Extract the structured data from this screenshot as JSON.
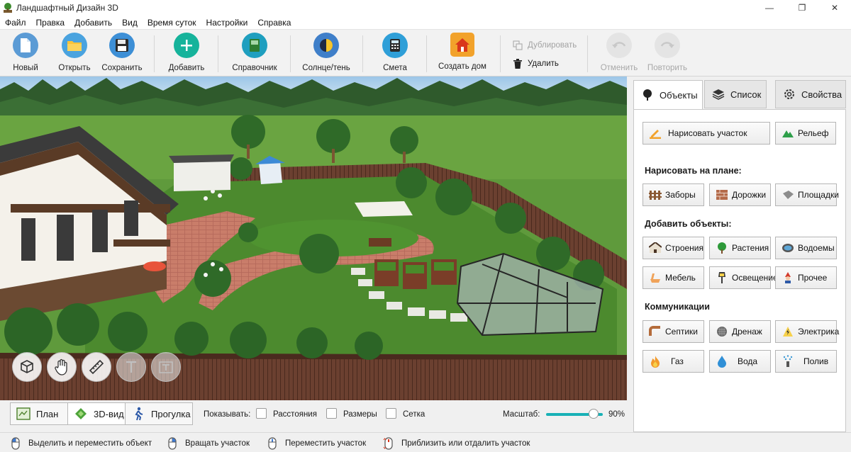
{
  "window": {
    "title": "Ландшафтный Дизайн 3D",
    "controls": {
      "minimize": "—",
      "maximize": "❐",
      "close": "✕"
    }
  },
  "menu": [
    "Файл",
    "Правка",
    "Добавить",
    "Вид",
    "Время суток",
    "Настройки",
    "Справка"
  ],
  "toolbar": {
    "new": "Новый",
    "open": "Открыть",
    "save": "Сохранить",
    "add": "Добавить",
    "reference": "Справочник",
    "sun_shadow": "Солнце/тень",
    "estimate": "Смета",
    "create_house": "Создать дом",
    "duplicate": "Дублировать",
    "delete": "Удалить",
    "undo": "Отменить",
    "redo": "Повторить"
  },
  "icons": {
    "new": "document-icon",
    "open": "folder-icon",
    "save": "floppy-icon",
    "add": "plus-icon",
    "reference": "book-icon",
    "sun_shadow": "sun-moon-icon",
    "estimate": "calculator-icon",
    "create_house": "house-icon"
  },
  "colors": {
    "accent": "#18b1b6",
    "new_bg": "#5b9bd5",
    "open_bg": "#4aa3df",
    "save_bg": "#3d8fd6",
    "add_bg": "#16b39b",
    "reference_bg": "#1f9fbf",
    "sun_bg": "#3f7fc9",
    "estimate_bg": "#2f9fd8",
    "house_bg": "#f2a22b"
  },
  "view_tabs": {
    "plan": "План",
    "view3d": "3D-вид",
    "walk": "Прогулка"
  },
  "show": {
    "label": "Показывать:",
    "distances": "Расстояния",
    "sizes": "Размеры",
    "grid": "Сетка"
  },
  "zoom": {
    "label": "Масштаб:",
    "value_text": "90%",
    "value": 90
  },
  "status": {
    "select_move": "Выделить и переместить объект",
    "rotate": "Вращать участок",
    "move": "Переместить участок",
    "zoom": "Приблизить или отдалить участок"
  },
  "panel": {
    "tabs": {
      "objects": "Объекты",
      "list": "Список",
      "properties": "Свойства"
    },
    "draw_plot": "Нарисовать участок",
    "relief": "Рельеф",
    "draw_on_plan": "Нарисовать на плане:",
    "fences": "Заборы",
    "paths": "Дорожки",
    "areas": "Площадки",
    "add_objects": "Добавить объекты:",
    "buildings": "Строения",
    "plants": "Растения",
    "ponds": "Водоемы",
    "furniture": "Мебель",
    "lighting": "Освещение",
    "other": "Прочее",
    "communications": "Коммуникации",
    "septics": "Септики",
    "drainage": "Дренаж",
    "electric": "Электрика",
    "gas": "Газ",
    "water": "Вода",
    "irrigation": "Полив"
  }
}
